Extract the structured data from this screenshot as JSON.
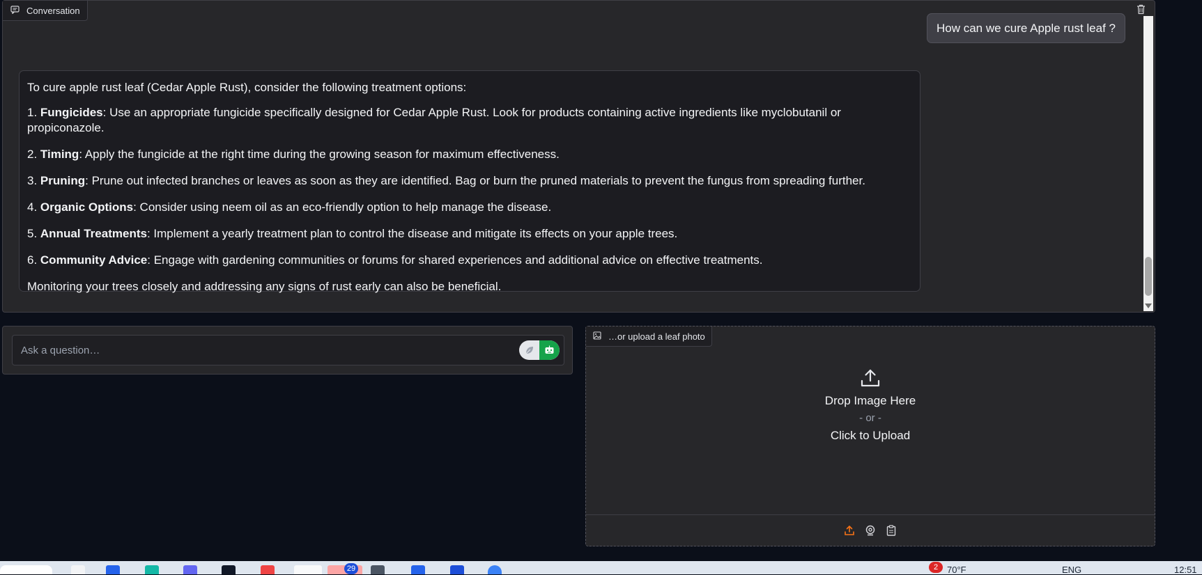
{
  "chat": {
    "label": "Conversation",
    "user_message": "How can we cure Apple rust leaf ?",
    "bot_intro": "To cure apple rust leaf (Cedar Apple Rust), consider the following treatment options:",
    "items": [
      {
        "num": "1. ",
        "title": "Fungicides",
        "text": ": Use an appropriate fungicide specifically designed for Cedar Apple Rust. Look for products containing active ingredients like myclobutanil or propiconazole."
      },
      {
        "num": "2. ",
        "title": "Timing",
        "text": ": Apply the fungicide at the right time during the growing season for maximum effectiveness."
      },
      {
        "num": "3. ",
        "title": "Pruning",
        "text": ": Prune out infected branches or leaves as soon as they are identified. Bag or burn the pruned materials to prevent the fungus from spreading further."
      },
      {
        "num": "4. ",
        "title": "Organic Options",
        "text": ": Consider using neem oil as an eco-friendly option to help manage the disease."
      },
      {
        "num": "5. ",
        "title": "Annual Treatments",
        "text": ": Implement a yearly treatment plan to control the disease and mitigate its effects on your apple trees."
      },
      {
        "num": "6. ",
        "title": "Community Advice",
        "text": ": Engage with gardening communities or forums for shared experiences and additional advice on effective treatments."
      }
    ],
    "bot_outro": "Monitoring your trees closely and addressing any signs of rust early can also be beneficial."
  },
  "question": {
    "placeholder": "Ask a question…",
    "value": ""
  },
  "upload": {
    "label": "…or upload a leaf photo",
    "drop_title": "Drop Image Here",
    "drop_or": "- or -",
    "drop_click": "Click to Upload",
    "sources": [
      "upload-icon",
      "webcam-icon",
      "clipboard-icon"
    ],
    "active_source_color": "#f97316"
  },
  "taskbar": {
    "badge_count": "29",
    "weather_alert_count": "2",
    "temperature": "70°F",
    "language": "ENG",
    "clock": "12:51"
  },
  "colors": {
    "panel_bg": "#27272a",
    "page_bg": "#0b0f19",
    "toggle_accent": "#16a34a"
  }
}
